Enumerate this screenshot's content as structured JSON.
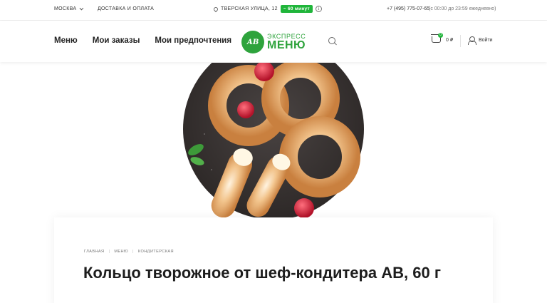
{
  "topbar": {
    "city": "МОСКВА",
    "delivery": "ДОСТАВКА И ОПЛАТА",
    "address": "ТВЕРСКАЯ УЛИЦА, 12",
    "badge": "~ 60 минут",
    "info": "i",
    "phone": "+7 (495) 775-07-65",
    "hours": "(с 00:00 до 23:59 ежедневно)"
  },
  "header": {
    "nav": [
      "Меню",
      "Мои заказы",
      "Мои предпочтения"
    ],
    "logo_mark": "АВ",
    "logo_top": "ЭКСПРЕСС",
    "logo_bottom": "МЕНЮ",
    "cart_count": "0",
    "cart_sum": "0 ₽",
    "login": "Войти"
  },
  "product": {
    "breadcrumbs": [
      "ГЛАВНАЯ",
      "МЕНЮ",
      "КОНДИТЕРСКАЯ"
    ],
    "title": "Кольцо творожное от шеф-кондитера АВ, 60 г"
  },
  "colors": {
    "accent": "#1fb53a",
    "logo": "#2ea33c"
  }
}
